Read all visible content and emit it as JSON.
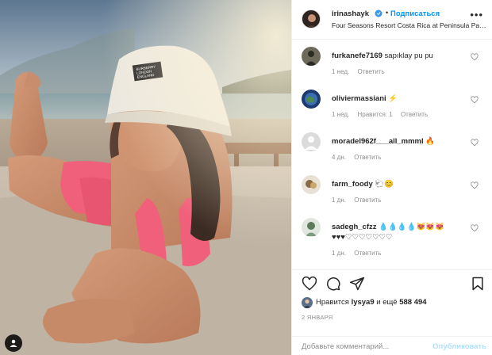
{
  "post": {
    "author": "irinashayk",
    "follow_label": "Подписаться",
    "dot": "•",
    "location": "Four Seasons Resort Costa Rica at Peninsula Papagayo",
    "more_label": "•••",
    "hat_text": "BURBERRY LONDON ENGLAND"
  },
  "comments": [
    {
      "username": "furkanefe7169",
      "text": "sapıklay pu pu",
      "time": "1 нед.",
      "likes": "",
      "reply": "Ответить"
    },
    {
      "username": "oliviermassiani",
      "text": "⚡",
      "time": "1 нед.",
      "likes": "Нравится: 1",
      "reply": "Ответить"
    },
    {
      "username": "moradel962f___all_mmml",
      "text": "🔥",
      "time": "4 дн.",
      "likes": "",
      "reply": "Ответить"
    },
    {
      "username": "farm_foody",
      "text": "🐑😊",
      "time": "1 дн.",
      "likes": "",
      "reply": "Ответить"
    },
    {
      "username": "sadegh_cfzz",
      "text": "💧💧💧💧😻😻😻 ♥♥♥♡♡♡♡♡♡♡",
      "time": "1 дн.",
      "likes": "",
      "reply": "Ответить"
    }
  ],
  "likes": {
    "prefix": "Нравится ",
    "user": "lysya9",
    "middle": " и ещё ",
    "count": "588 494"
  },
  "date": "2 ЯНВАРЯ",
  "add_comment": {
    "placeholder": "Добавьте комментарий...",
    "post_label": "Опубликовать"
  },
  "colors": {
    "link_blue": "#0095f6",
    "post_disabled": "#b2dffc",
    "swimsuit": "#f0607a",
    "hat": "#ece8df"
  },
  "icons": [
    "verified-badge-icon",
    "heart-icon",
    "comment-icon",
    "share-icon",
    "bookmark-icon",
    "user-tag-icon"
  ]
}
